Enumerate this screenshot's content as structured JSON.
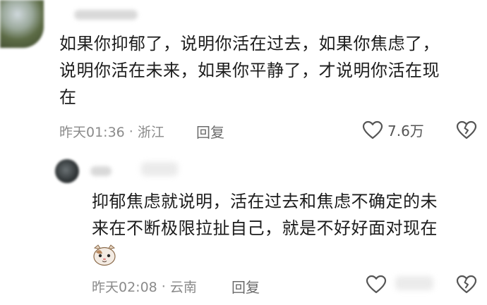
{
  "main_comment": {
    "text_lines": [
      "如果你抑郁了，说明你活在过去，如果你焦虑了，",
      "说明你活在未来，如果你平静了，才说明你活在现",
      "在"
    ],
    "time": "昨天01:36",
    "location": "浙江",
    "reply_label": "回复",
    "like_count": "7.6万"
  },
  "sub_reply": {
    "text_lines": [
      "抑郁焦虑就说明，活在过去和焦虑不确定的未",
      "来在不断极限拉扯自己，就是不好好面对现在"
    ],
    "emoji_name": "cat-face-emoji",
    "time": "昨天02:08",
    "location": "云南",
    "reply_label": "回复"
  },
  "icons": {
    "like": "heart-outline-icon",
    "dislike": "broken-heart-icon"
  },
  "colors": {
    "text": "#1c1c1c",
    "meta": "#8a8a8a",
    "icon": "#555555"
  }
}
